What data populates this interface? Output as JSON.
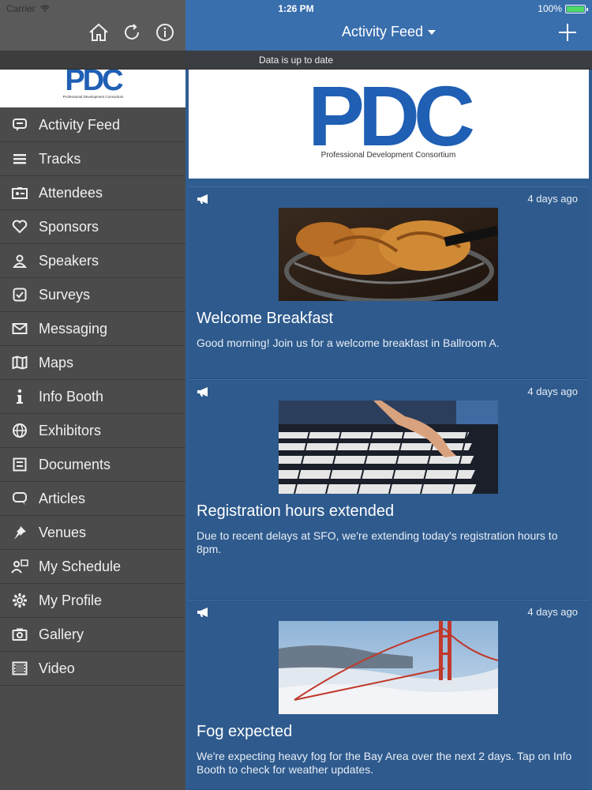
{
  "status_bar": {
    "carrier": "Carrier",
    "time": "1:26 PM",
    "battery": "100%",
    "battery_level": 1.0
  },
  "sidebar": {
    "items": [
      {
        "label": "Activity Feed",
        "icon": "chat-bubble-icon"
      },
      {
        "label": "Tracks",
        "icon": "list-icon"
      },
      {
        "label": "Attendees",
        "icon": "id-card-icon"
      },
      {
        "label": "Sponsors",
        "icon": "heart-icon"
      },
      {
        "label": "Speakers",
        "icon": "person-icon"
      },
      {
        "label": "Surveys",
        "icon": "checkbox-icon"
      },
      {
        "label": "Messaging",
        "icon": "envelope-icon"
      },
      {
        "label": "Maps",
        "icon": "map-icon"
      },
      {
        "label": "Info Booth",
        "icon": "info-icon"
      },
      {
        "label": "Exhibitors",
        "icon": "globe-icon"
      },
      {
        "label": "Documents",
        "icon": "document-icon"
      },
      {
        "label": "Articles",
        "icon": "speech-icon"
      },
      {
        "label": "Venues",
        "icon": "pin-icon"
      },
      {
        "label": "My Schedule",
        "icon": "person-calendar-icon"
      },
      {
        "label": "My Profile",
        "icon": "gear-icon"
      },
      {
        "label": "Gallery",
        "icon": "camera-icon"
      },
      {
        "label": "Video",
        "icon": "film-icon"
      }
    ]
  },
  "banner": {
    "sync_text": "Data is up to date"
  },
  "header": {
    "title": "Activity Feed"
  },
  "logo": {
    "letters": "PDC",
    "subtitle": "Professional Development Consortium"
  },
  "feed": [
    {
      "time": "4 days ago",
      "title": "Welcome Breakfast",
      "body": "Good morning! Join us for a welcome breakfast in Ballroom A.",
      "image": "croissants"
    },
    {
      "time": "4 days ago",
      "title": "Registration hours extended",
      "body": "Due to recent delays at SFO, we're extending today's registration hours to 8pm.",
      "image": "keyboard-hand"
    },
    {
      "time": "4 days ago",
      "title": "Fog expected",
      "body": "We're expecting heavy fog for the Bay Area over the next 2 days. Tap on Info Booth to check for weather updates.",
      "image": "golden-gate-bridge"
    }
  ],
  "colors": {
    "sidebar": "#4b4b4b",
    "header": "#3a6fae",
    "main": "#2f5d92",
    "logo_blue": "#1f5fb4"
  }
}
